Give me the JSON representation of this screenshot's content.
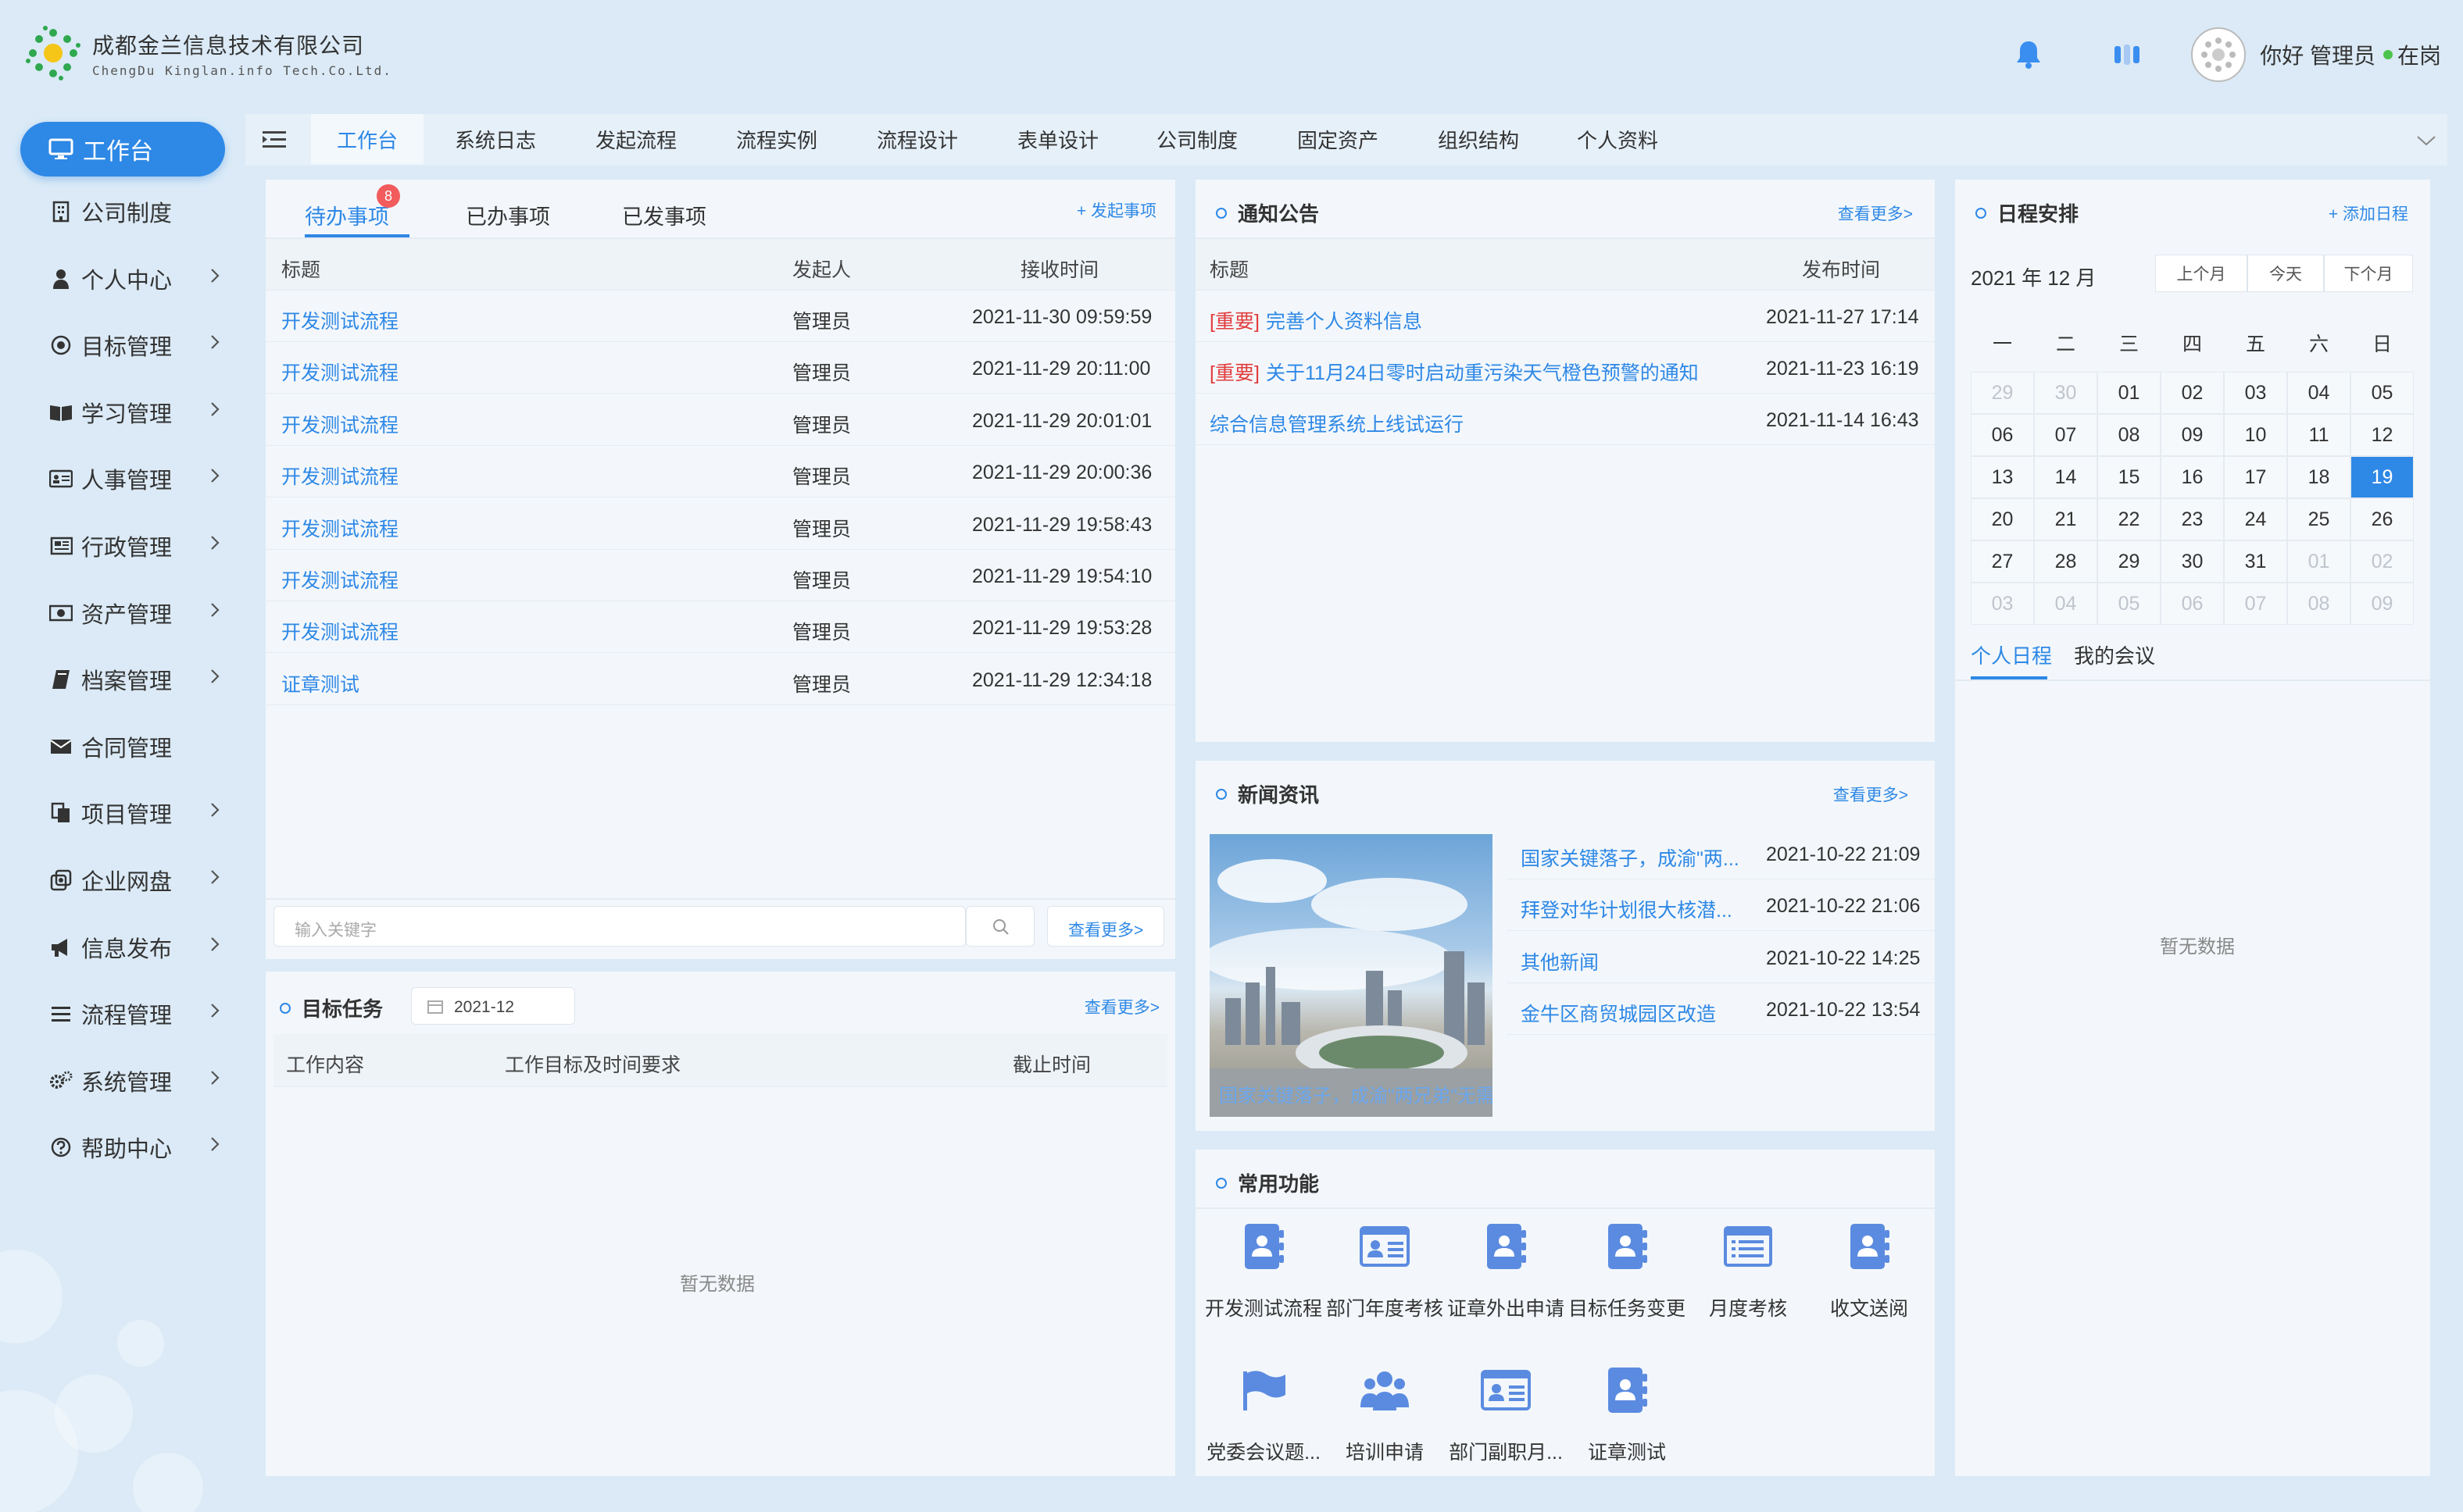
{
  "company": {
    "name_cn": "成都金兰信息技术有限公司",
    "name_en": "ChengDu Kinglan.info Tech.Co.Ltd."
  },
  "user": {
    "greeting": "你好 管理员",
    "status": "在岗"
  },
  "sidebar": {
    "active": "工作台",
    "items": [
      {
        "label": "公司制度",
        "icon": "building-icon",
        "chevron": false
      },
      {
        "label": "个人中心",
        "icon": "person-icon",
        "chevron": true
      },
      {
        "label": "目标管理",
        "icon": "target-icon",
        "chevron": true
      },
      {
        "label": "学习管理",
        "icon": "book-open-icon",
        "chevron": true
      },
      {
        "label": "人事管理",
        "icon": "id-card-icon",
        "chevron": true
      },
      {
        "label": "行政管理",
        "icon": "newspaper-icon",
        "chevron": true
      },
      {
        "label": "资产管理",
        "icon": "money-icon",
        "chevron": true
      },
      {
        "label": "档案管理",
        "icon": "archive-book-icon",
        "chevron": true
      },
      {
        "label": "合同管理",
        "icon": "envelope-icon",
        "chevron": false
      },
      {
        "label": "项目管理",
        "icon": "copy-icon",
        "chevron": true
      },
      {
        "label": "企业网盘",
        "icon": "cloud-disk-icon",
        "chevron": true
      },
      {
        "label": "信息发布",
        "icon": "megaphone-icon",
        "chevron": true
      },
      {
        "label": "流程管理",
        "icon": "list-icon",
        "chevron": true
      },
      {
        "label": "系统管理",
        "icon": "gears-icon",
        "chevron": true
      },
      {
        "label": "帮助中心",
        "icon": "help-icon",
        "chevron": true
      }
    ]
  },
  "tabs": [
    "工作台",
    "系统日志",
    "发起流程",
    "流程实例",
    "流程设计",
    "表单设计",
    "公司制度",
    "固定资产",
    "组织结构",
    "个人资料"
  ],
  "tasks": {
    "tabs": [
      "待办事项",
      "已办事项",
      "已发事项"
    ],
    "badge": "8",
    "action": "+ 发起事项",
    "columns": [
      "标题",
      "发起人",
      "接收时间"
    ],
    "rows": [
      {
        "title": "开发测试流程",
        "sender": "管理员",
        "time": "2021-11-30 09:59:59"
      },
      {
        "title": "开发测试流程",
        "sender": "管理员",
        "time": "2021-11-29 20:11:00"
      },
      {
        "title": "开发测试流程",
        "sender": "管理员",
        "time": "2021-11-29 20:01:01"
      },
      {
        "title": "开发测试流程",
        "sender": "管理员",
        "time": "2021-11-29 20:00:36"
      },
      {
        "title": "开发测试流程",
        "sender": "管理员",
        "time": "2021-11-29 19:58:43"
      },
      {
        "title": "开发测试流程",
        "sender": "管理员",
        "time": "2021-11-29 19:54:10"
      },
      {
        "title": "开发测试流程",
        "sender": "管理员",
        "time": "2021-11-29 19:53:28"
      },
      {
        "title": "证章测试",
        "sender": "管理员",
        "time": "2021-11-29 12:34:18"
      }
    ],
    "search_placeholder": "输入关键字",
    "more": "查看更多>"
  },
  "goals": {
    "title": "目标任务",
    "date": "2021-12",
    "more": "查看更多>",
    "columns": [
      "工作内容",
      "工作目标及时间要求",
      "截止时间"
    ],
    "empty": "暂无数据"
  },
  "notice": {
    "title": "通知公告",
    "more": "查看更多>",
    "columns": [
      "标题",
      "发布时间"
    ],
    "rows": [
      {
        "tag": "[重要]",
        "title": "完善个人资料信息",
        "time": "2021-11-27 17:14"
      },
      {
        "tag": "[重要]",
        "title": "关于11月24日零时启动重污染天气橙色预警的通知",
        "time": "2021-11-23 16:19"
      },
      {
        "tag": "",
        "title": "综合信息管理系统上线试运行",
        "time": "2021-11-14 16:43"
      }
    ]
  },
  "news": {
    "title": "新闻资讯",
    "more": "查看更多>",
    "caption": "国家关键落子，成渝\"两兄弟\"无需",
    "rows": [
      {
        "title": "国家关键落子，成渝\"两...",
        "time": "2021-10-22 21:09"
      },
      {
        "title": "拜登对华计划很大核潜...",
        "time": "2021-10-22 21:06"
      },
      {
        "title": "其他新闻",
        "time": "2021-10-22 14:25"
      },
      {
        "title": "金牛区商贸城园区改造",
        "time": "2021-10-22 13:54"
      }
    ]
  },
  "functions": {
    "title": "常用功能",
    "items": [
      {
        "label": "开发测试流程",
        "icon": "contact-book-icon"
      },
      {
        "label": "部门年度考核",
        "icon": "id-card-icon"
      },
      {
        "label": "证章外出申请",
        "icon": "contact-book-icon"
      },
      {
        "label": "目标任务变更",
        "icon": "contact-book-icon"
      },
      {
        "label": "月度考核",
        "icon": "list-card-icon"
      },
      {
        "label": "收文送阅",
        "icon": "contact-book-icon"
      },
      {
        "label": "党委会议题...",
        "icon": "flag-icon"
      },
      {
        "label": "培训申请",
        "icon": "users-icon"
      },
      {
        "label": "部门副职月...",
        "icon": "id-card-icon"
      },
      {
        "label": "证章测试",
        "icon": "contact-book-icon"
      }
    ]
  },
  "schedule": {
    "title": "日程安排",
    "add": "+ 添加日程",
    "month_label": "2021 年 12 月",
    "buttons": [
      "上个月",
      "今天",
      "下个月"
    ],
    "weekdays": [
      "一",
      "二",
      "三",
      "四",
      "五",
      "六",
      "日"
    ],
    "days": [
      [
        "29",
        "30",
        "01",
        "02",
        "03",
        "04",
        "05"
      ],
      [
        "06",
        "07",
        "08",
        "09",
        "10",
        "11",
        "12"
      ],
      [
        "13",
        "14",
        "15",
        "16",
        "17",
        "18",
        "19"
      ],
      [
        "20",
        "21",
        "22",
        "23",
        "24",
        "25",
        "26"
      ],
      [
        "27",
        "28",
        "29",
        "30",
        "31",
        "01",
        "02"
      ],
      [
        "03",
        "04",
        "05",
        "06",
        "07",
        "08",
        "09"
      ]
    ],
    "selected_day": "19",
    "tabs": [
      "个人日程",
      "我的会议"
    ],
    "empty": "暂无数据"
  },
  "colors": {
    "accent": "#2e88e6",
    "important": "#e23c3c",
    "icon": "#5b8be0"
  }
}
